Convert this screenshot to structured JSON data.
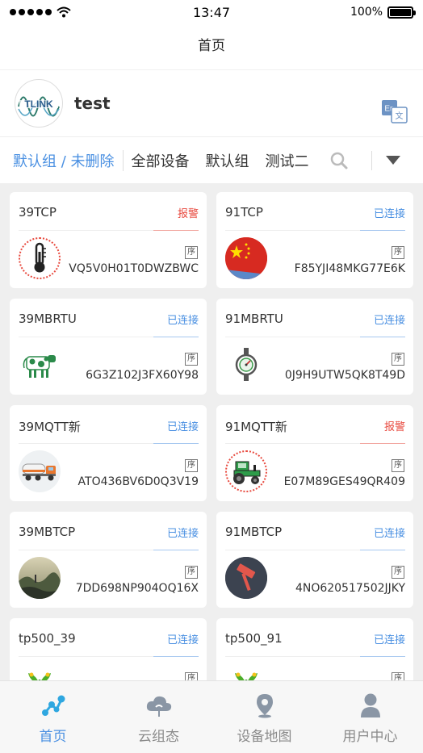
{
  "status_bar": {
    "time": "13:47",
    "battery": "100%"
  },
  "nav": {
    "title": "首页"
  },
  "user": {
    "name": "test"
  },
  "tabs": [
    {
      "label": "默认组 / 未删除",
      "active": true
    },
    {
      "label": "全部设备"
    },
    {
      "label": "默认组"
    },
    {
      "label": "测试二"
    }
  ],
  "devices": [
    {
      "name": "39TCP",
      "status": "报警",
      "status_type": "alarm",
      "seq": "序",
      "sn": "VQ5V0H01T0DWZBWC",
      "icon": "thermometer-icon"
    },
    {
      "name": "91TCP",
      "status": "已连接",
      "status_type": "online",
      "seq": "序",
      "sn": "F85YJI48MKG77E6K",
      "icon": "china-flag-icon"
    },
    {
      "name": "39MBRTU",
      "status": "已连接",
      "status_type": "online",
      "seq": "序",
      "sn": "6G3Z102J3FX60Y98",
      "icon": "cow-icon"
    },
    {
      "name": "91MBRTU",
      "status": "已连接",
      "status_type": "online",
      "seq": "序",
      "sn": "0J9H9UTW5QK8T49D",
      "icon": "pressure-gauge-icon"
    },
    {
      "name": "39MQTT新",
      "status": "已连接",
      "status_type": "online",
      "seq": "序",
      "sn": "ATO436BV6D0Q3V19",
      "icon": "tanker-truck-icon"
    },
    {
      "name": "91MQTT新",
      "status": "报警",
      "status_type": "alarm",
      "seq": "序",
      "sn": "E07M89GES49QR409",
      "icon": "tractor-icon"
    },
    {
      "name": "39MBTCP",
      "status": "已连接",
      "status_type": "online",
      "seq": "序",
      "sn": "7DD698NP904OQ16X",
      "icon": "landscape-photo-icon"
    },
    {
      "name": "91MBTCP",
      "status": "已连接",
      "status_type": "online",
      "seq": "序",
      "sn": "4NO620517502JJKY",
      "icon": "hammer-icon"
    },
    {
      "name": "tp500_39",
      "status": "已连接",
      "status_type": "online",
      "seq": "序",
      "sn": "",
      "icon": "plant-icon"
    },
    {
      "name": "tp500_91",
      "status": "已连接",
      "status_type": "online",
      "seq": "序",
      "sn": "",
      "icon": "plant-icon"
    }
  ],
  "tabbar": [
    {
      "label": "首页",
      "icon": "home-nodes-icon",
      "active": true
    },
    {
      "label": "云组态",
      "icon": "cloud-icon"
    },
    {
      "label": "设备地图",
      "icon": "map-pin-icon"
    },
    {
      "label": "用户中心",
      "icon": "user-icon"
    }
  ],
  "colors": {
    "accent": "#4a90e2",
    "alarm": "#e84a3f",
    "background": "#efefef"
  }
}
